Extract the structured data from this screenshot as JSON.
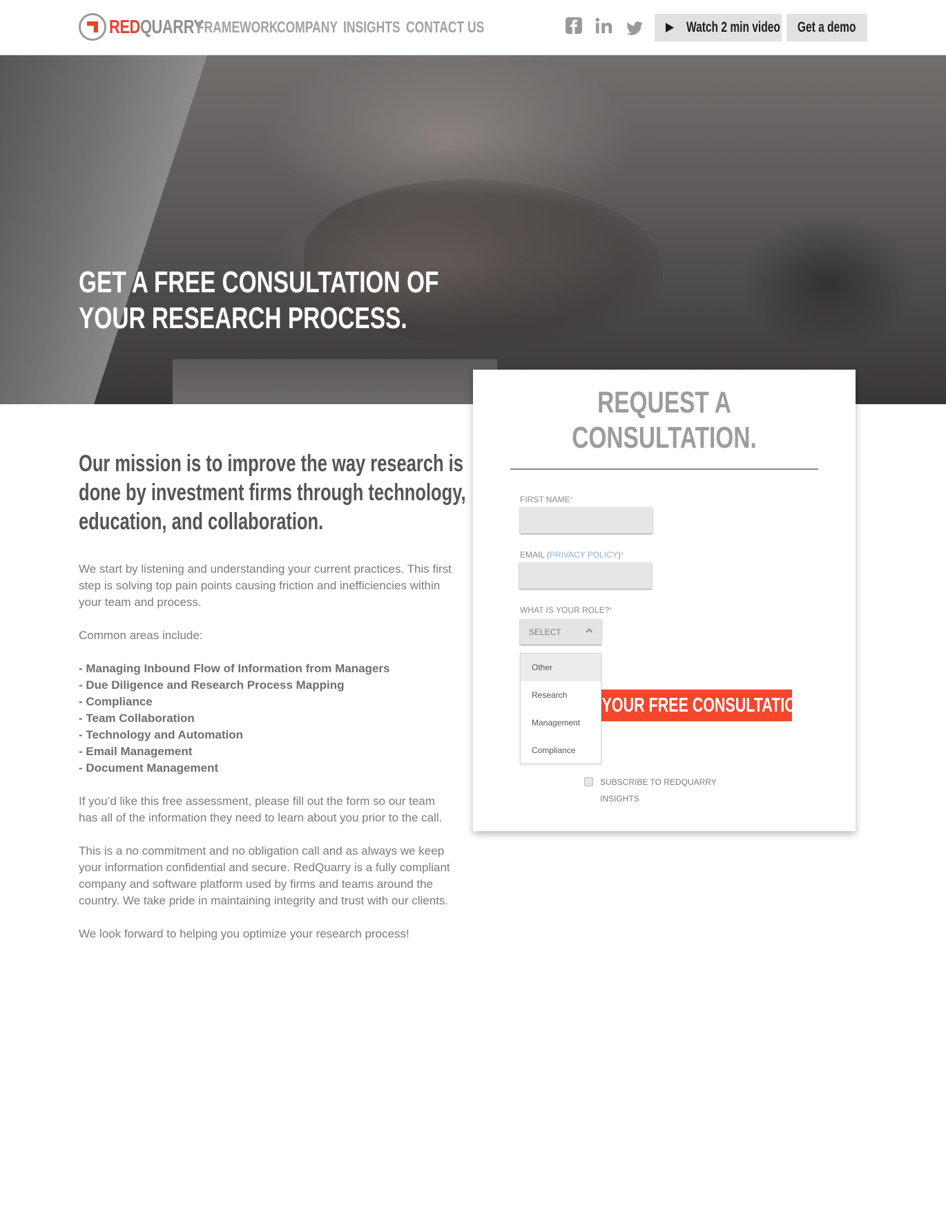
{
  "brand": {
    "name_red": "RED",
    "name_gray": "QUARRY",
    "accent": "#e8432c",
    "logo_icon": "redquarry-logo-icon"
  },
  "nav": {
    "items": [
      "FRAMEWORK",
      "COMPANY",
      "INSIGHTS",
      "CONTACT US"
    ]
  },
  "social": {
    "icons": [
      "facebook-icon",
      "linkedin-icon",
      "twitter-icon"
    ]
  },
  "header_buttons": {
    "video_label": "Watch 2 min video",
    "video_icon": "play-icon",
    "demo_label": "Get a demo"
  },
  "hero": {
    "title_line1": "GET A FREE CONSULTATION OF",
    "title_line2": "YOUR RESEARCH PROCESS."
  },
  "content": {
    "mission_line1": "Our mission is to improve the way research is",
    "mission_line2": "done by investment firms through technology,",
    "mission_line3": "education, and collaboration.",
    "intro": "We start by listening and understanding your current practices. This first step is solving top pain points causing friction and inefficiencies within your team and process.",
    "areas_heading": "Common areas include:",
    "areas": [
      "- Managing Inbound Flow of Information from Managers",
      "- Due Diligence and Research Process Mapping",
      "- Compliance",
      "- Team Collaboration",
      "- Technology and Automation",
      "- Email Management",
      "- Document Management"
    ],
    "assessment": "If you’d like this free assessment, please fill out the form so our team has all of the information they need to learn about you prior to the call.",
    "commitment": "This is a no commitment and no obligation call and as always we keep your information confidential and secure. RedQuarry is a fully compliant company and software platform used by firms and teams around the country. We take pride in maintaining integrity and trust with our clients.",
    "closing": "We look forward to helping you optimize your research process!"
  },
  "form": {
    "title_line1": "REQUEST A",
    "title_line2": "CONSULTATION.",
    "first_name_label": "FIRST NAME",
    "email_label_prefix": "EMAIL (",
    "privacy_link": "PRIVACY POLICY",
    "email_label_suffix": ")",
    "required_mark": "*",
    "role_label": "WHAT IS YOUR ROLE?",
    "select_value": "SELECT",
    "role_options": [
      "Other",
      "Research",
      "Management",
      "Compliance"
    ],
    "submit_label": "GET YOUR FREE CONSULTATION",
    "subscribe_label": "SUBSCRIBE TO REDQUARRY INSIGHTS",
    "submit_color": "#f4462b"
  }
}
